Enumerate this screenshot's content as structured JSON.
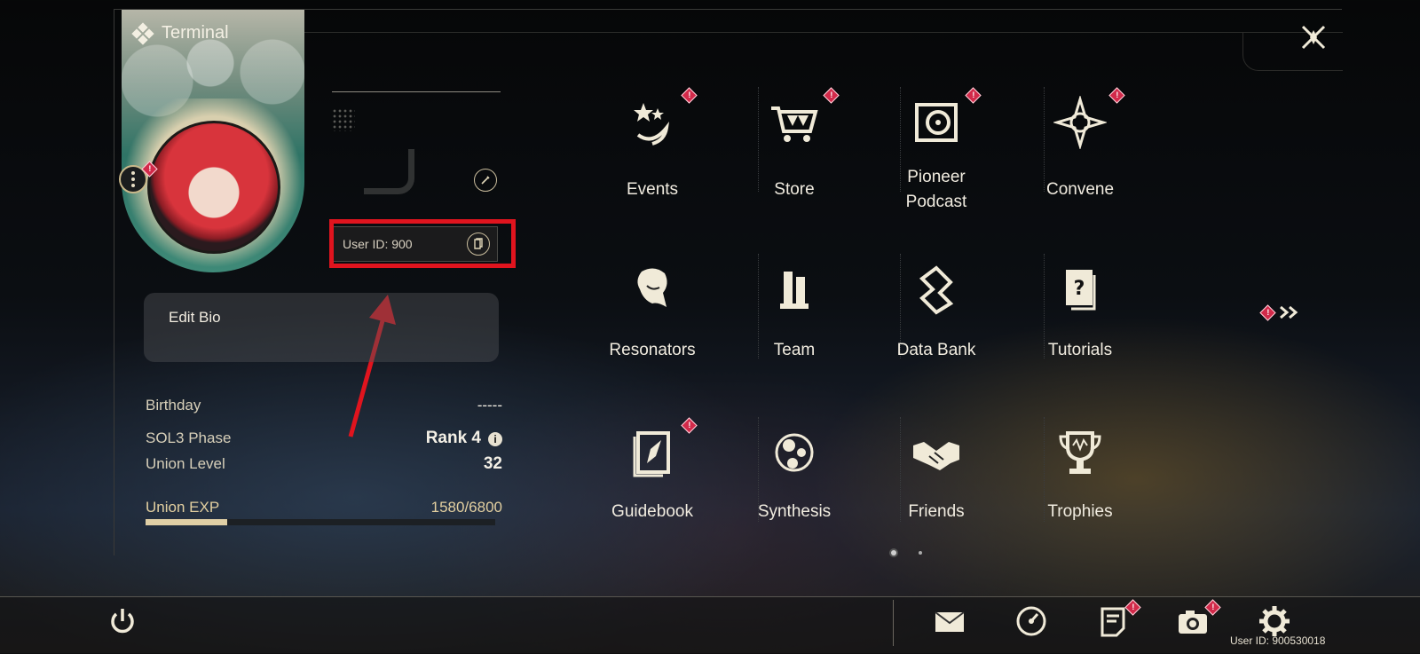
{
  "header": {
    "title": "Terminal"
  },
  "profile": {
    "user_id_label": "User ID: 900",
    "bio_label": "Edit Bio",
    "stats": [
      {
        "label": "Birthday",
        "value": "-----"
      },
      {
        "label": "SOL3 Phase",
        "value": "Rank 4"
      },
      {
        "label": "Union Level",
        "value": "32"
      }
    ],
    "exp": {
      "label": "Union EXP",
      "value": "1580/6800",
      "current": 1580,
      "max": 6800
    }
  },
  "menu": {
    "items": [
      {
        "label": "Events",
        "icon": "events-icon",
        "badge": true
      },
      {
        "label": "Store",
        "icon": "cart-icon",
        "badge": true
      },
      {
        "label": "Pioneer Podcast",
        "icon": "podcast-icon",
        "badge": true
      },
      {
        "label": "Convene",
        "icon": "convene-icon",
        "badge": true
      },
      {
        "label": "Resonators",
        "icon": "resonator-icon",
        "badge": false
      },
      {
        "label": "Team",
        "icon": "team-icon",
        "badge": false
      },
      {
        "label": "Data Bank",
        "icon": "data-bank-icon",
        "badge": false
      },
      {
        "label": "Tutorials",
        "icon": "tutorials-icon",
        "badge": false
      },
      {
        "label": "Guidebook",
        "icon": "guidebook-icon",
        "badge": true
      },
      {
        "label": "Synthesis",
        "icon": "synthesis-icon",
        "badge": false
      },
      {
        "label": "Friends",
        "icon": "handshake-icon",
        "badge": false
      },
      {
        "label": "Trophies",
        "icon": "trophy-icon",
        "badge": false
      }
    ],
    "page": {
      "current": 1,
      "total": 2
    }
  },
  "bottom_bar": {
    "user_id": "User ID: 900530018",
    "icons": [
      "power-icon",
      "mail-icon",
      "compass-icon",
      "notice-icon",
      "camera-icon",
      "settings-gear-icon"
    ]
  },
  "colors": {
    "accent": "#e0cfa5",
    "badge": "#d22a4a",
    "highlight": "#e0141e"
  }
}
